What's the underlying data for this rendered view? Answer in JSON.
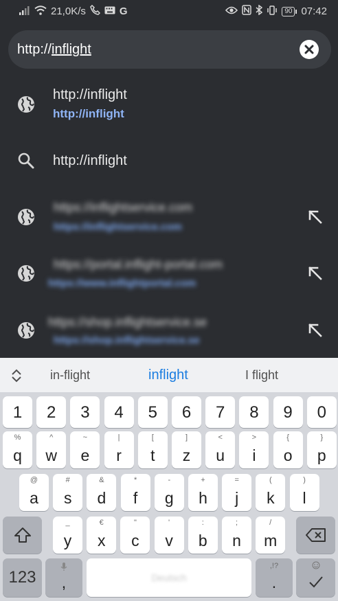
{
  "status_bar": {
    "speed": "21,0K/s",
    "battery": "90",
    "time": "07:42",
    "left_icons": [
      "signal-icon",
      "wifi-icon",
      "phone-icon",
      "keyboard-icon",
      "google-icon"
    ],
    "right_icons": [
      "eye-icon",
      "nfc-icon",
      "bluetooth-icon",
      "vibrate-icon",
      "battery-icon"
    ]
  },
  "url_bar": {
    "prefix": "http://",
    "selected": "inflight"
  },
  "suggestions": [
    {
      "icon": "globe-icon",
      "title": "http://inflight",
      "url": "http://inflight"
    },
    {
      "icon": "search-icon",
      "title": "http://inflight"
    },
    {
      "icon": "globe-icon",
      "title": "https://inflightservice.com",
      "url": "https://inflightservice.com",
      "blurred": true
    },
    {
      "icon": "globe-icon",
      "title": "https://portal.inflight-portal.com",
      "url": "https://www.inflightportal.com",
      "blurred": true
    },
    {
      "icon": "globe-icon",
      "title": "https://shop.inflightservice.se",
      "url": "https://shop.inflightservice.se",
      "blurred": true
    }
  ],
  "keyboard": {
    "suggestions": [
      "in-flight",
      "inflight",
      "I flight"
    ],
    "number_row": [
      "1",
      "2",
      "3",
      "4",
      "5",
      "6",
      "7",
      "8",
      "9",
      "0"
    ],
    "row1": [
      {
        "main": "q",
        "alt": "%"
      },
      {
        "main": "w",
        "alt": "^"
      },
      {
        "main": "e",
        "alt": "~"
      },
      {
        "main": "r",
        "alt": "|"
      },
      {
        "main": "t",
        "alt": "["
      },
      {
        "main": "z",
        "alt": "]"
      },
      {
        "main": "u",
        "alt": "<"
      },
      {
        "main": "i",
        "alt": ">"
      },
      {
        "main": "o",
        "alt": "{"
      },
      {
        "main": "p",
        "alt": "}"
      }
    ],
    "row2": [
      {
        "main": "a",
        "alt": "@"
      },
      {
        "main": "s",
        "alt": "#"
      },
      {
        "main": "d",
        "alt": "&"
      },
      {
        "main": "f",
        "alt": "*"
      },
      {
        "main": "g",
        "alt": "-"
      },
      {
        "main": "h",
        "alt": "+"
      },
      {
        "main": "j",
        "alt": "="
      },
      {
        "main": "k",
        "alt": "("
      },
      {
        "main": "l",
        "alt": ")"
      }
    ],
    "row3": [
      {
        "main": "y",
        "alt": "_"
      },
      {
        "main": "x",
        "alt": "€"
      },
      {
        "main": "c",
        "alt": "\""
      },
      {
        "main": "v",
        "alt": "'"
      },
      {
        "main": "b",
        "alt": ":"
      },
      {
        "main": "n",
        "alt": ";"
      },
      {
        "main": "m",
        "alt": "/"
      }
    ],
    "symbols_label": "123",
    "comma": ",",
    "period": ".",
    "period_alt": ",!?",
    "space_label": "Deutsch"
  }
}
